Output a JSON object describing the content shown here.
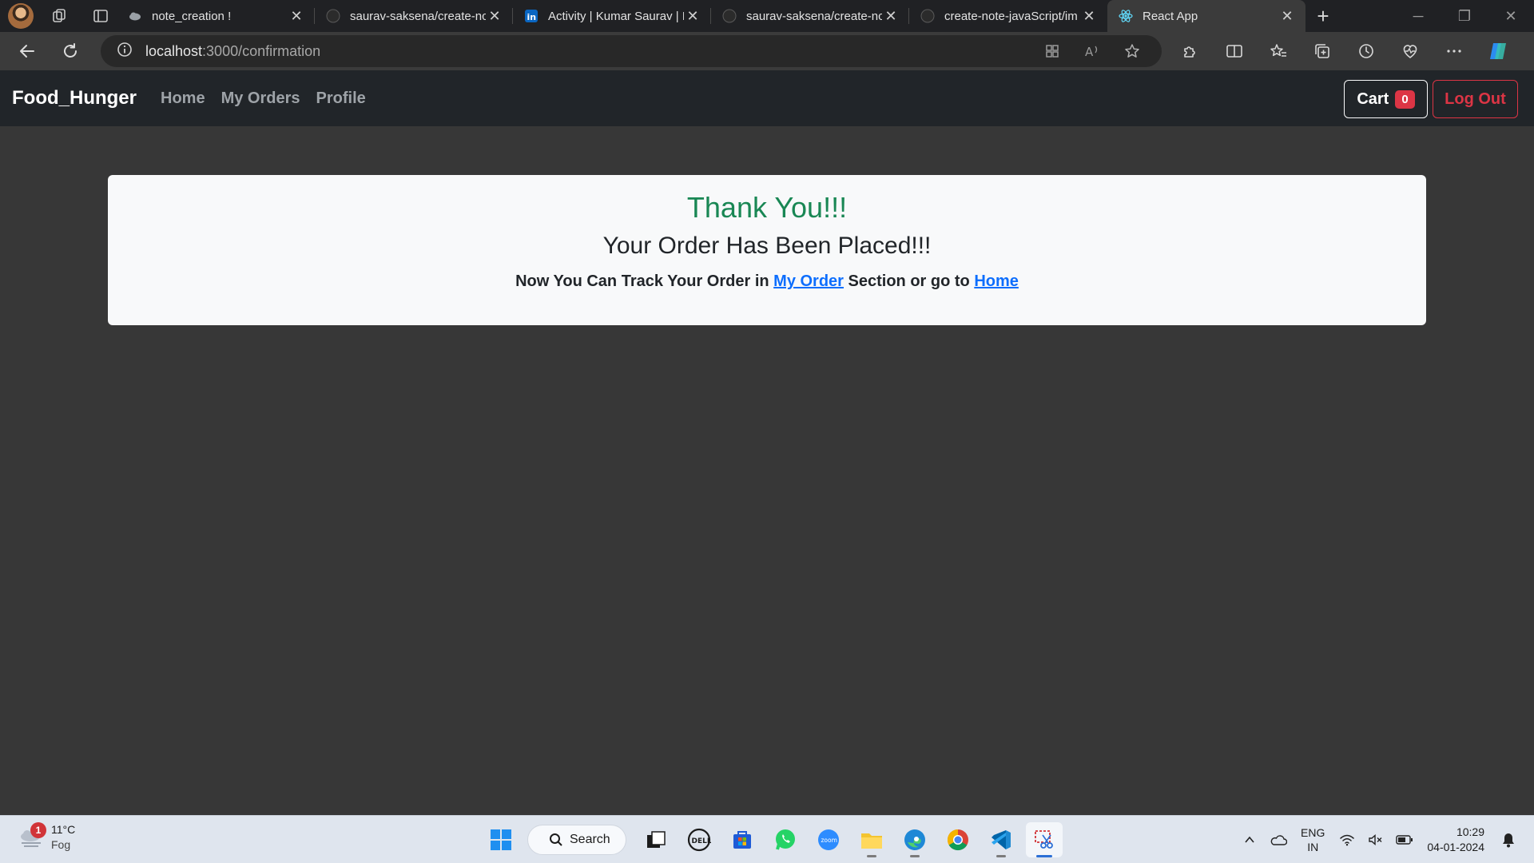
{
  "browser": {
    "tabs": [
      {
        "title": "note_creation !",
        "favicon": "cloud-icon"
      },
      {
        "title": "saurav-saksena/create-nc",
        "favicon": "github-icon"
      },
      {
        "title": "Activity | Kumar Saurav | L",
        "favicon": "linkedin-icon"
      },
      {
        "title": "saurav-saksena/create-nc",
        "favicon": "github-icon"
      },
      {
        "title": "create-note-javaScript/im",
        "favicon": "github-icon"
      },
      {
        "title": "React App",
        "favicon": "react-icon"
      }
    ],
    "url_host": "localhost",
    "url_path": ":3000/confirmation"
  },
  "app": {
    "brand": "Food_Hunger",
    "nav_links": [
      "Home",
      "My Orders",
      "Profile"
    ],
    "cart_label": "Cart",
    "cart_count": "0",
    "logout_label": "Log Out"
  },
  "confirmation": {
    "thank_you": "Thank You!!!",
    "placed": "Your Order Has Been Placed!!!",
    "track_prefix": "Now You Can Track Your Order in",
    "my_order_link": "My Order",
    "track_middle": "Section or go to",
    "home_link": "Home"
  },
  "taskbar": {
    "weather_badge": "1",
    "temperature": "11°C",
    "condition": "Fog",
    "search_label": "Search",
    "lang_top": "ENG",
    "lang_bottom": "IN",
    "time": "10:29",
    "date": "04-01-2024"
  },
  "colors": {
    "page_bg": "#373737",
    "navbar_bg": "#212529",
    "success": "#198754",
    "danger": "#dc3545",
    "link": "#0d6efd"
  }
}
